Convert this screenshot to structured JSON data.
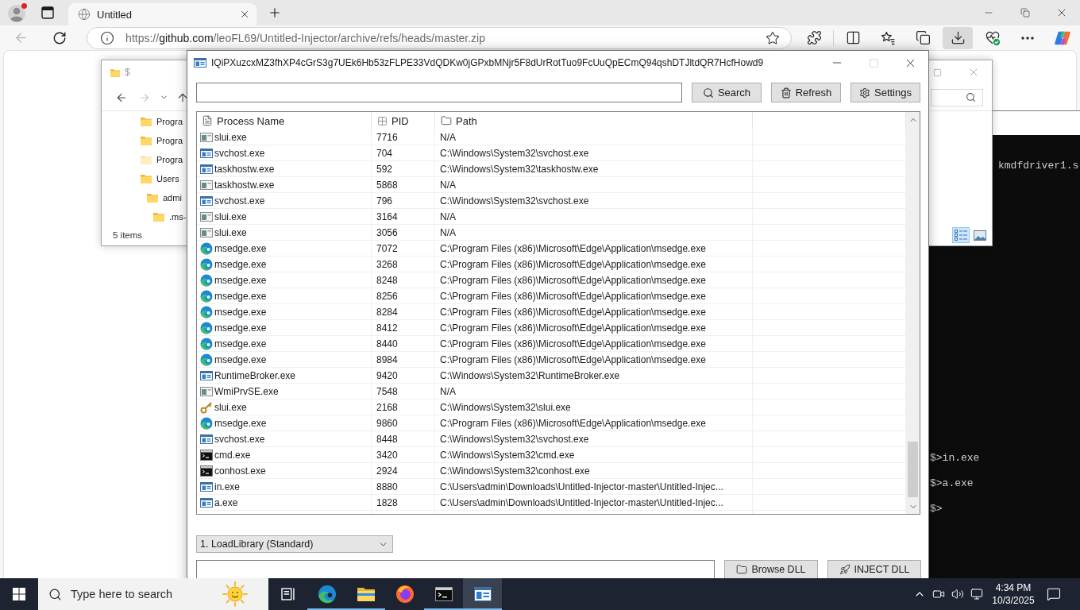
{
  "browser": {
    "tabs": [
      {
        "title": "Untitled",
        "selected": true
      }
    ],
    "nav": [
      {
        "kind": "back",
        "disabled": true
      },
      {
        "kind": "refresh",
        "disabled": false
      }
    ],
    "address": {
      "scheme": "https://",
      "host": "github.com",
      "path": "/leoFL69/Untitled-Injector/archive/refs/heads/master.zip"
    },
    "toolbar": [
      {
        "kind": "extensions",
        "selected": false
      },
      {
        "kind": "split",
        "selected": false
      },
      {
        "kind": "favorites",
        "selected": false
      },
      {
        "kind": "collections",
        "selected": false
      },
      {
        "kind": "downloads",
        "selected": true
      },
      {
        "kind": "essentials",
        "selected": false
      },
      {
        "kind": "more",
        "selected": false
      },
      {
        "kind": "copilot",
        "selected": false
      }
    ]
  },
  "explorer": {
    "title": "$",
    "nav": [
      {
        "kind": "back",
        "disabled": false
      },
      {
        "kind": "forward",
        "disabled": true
      },
      {
        "kind": "recent",
        "disabled": false
      },
      {
        "kind": "up",
        "disabled": false
      }
    ],
    "tree": [
      {
        "label": "Progra",
        "hidden": false
      },
      {
        "label": "Progra",
        "hidden": false
      },
      {
        "label": "Progra",
        "hidden": true
      },
      {
        "label": "Users",
        "hidden": false,
        "children": [
          {
            "label": "admi",
            "hidden": false,
            "children": [
              {
                "label": ".ms-",
                "hidden": false
              }
            ]
          }
        ]
      }
    ],
    "status": "5 items",
    "views": [
      {
        "kind": "details",
        "selected": true
      },
      {
        "kind": "thumbnails",
        "selected": false
      }
    ]
  },
  "console": {
    "output": "kmdfdriver1.s",
    "prompt_lines": [
      "$>in.exe",
      "$>a.exe",
      "$>"
    ]
  },
  "injector": {
    "title": "IQiPXuzcxMZ3fhXP4cGrS3g7UEk6Hb53zFLPE33VdQDKw0jGPxbMNjr5F8dUrRotTuo9FcUuQpECmQ94qshDTJltdQR7HcfHowd9",
    "controls": [
      {
        "kind": "minimize",
        "disabled": false
      },
      {
        "kind": "maximize",
        "disabled": true
      },
      {
        "kind": "close",
        "disabled": false
      }
    ],
    "toolbar_buttons": [
      {
        "kind": "search",
        "label": "Search"
      },
      {
        "kind": "refresh",
        "label": "Refresh"
      },
      {
        "kind": "settings",
        "label": "Settings"
      }
    ],
    "columns": [
      {
        "kind": "document",
        "label": "Process Name"
      },
      {
        "kind": "grid",
        "label": "PID"
      },
      {
        "kind": "folder",
        "label": "Path"
      }
    ],
    "rows": [
      {
        "kind": "app",
        "name": "slui.exe",
        "pid": "7716",
        "path": "N/A"
      },
      {
        "kind": "window",
        "name": "svchost.exe",
        "pid": "704",
        "path": "C:\\Windows\\System32\\svchost.exe"
      },
      {
        "kind": "window",
        "name": "taskhostw.exe",
        "pid": "592",
        "path": "C:\\Windows\\System32\\taskhostw.exe"
      },
      {
        "kind": "app",
        "name": "taskhostw.exe",
        "pid": "5868",
        "path": "N/A"
      },
      {
        "kind": "window",
        "name": "svchost.exe",
        "pid": "796",
        "path": "C:\\Windows\\System32\\svchost.exe"
      },
      {
        "kind": "app",
        "name": "slui.exe",
        "pid": "3164",
        "path": "N/A"
      },
      {
        "kind": "app",
        "name": "slui.exe",
        "pid": "3056",
        "path": "N/A"
      },
      {
        "kind": "edge",
        "name": "msedge.exe",
        "pid": "7072",
        "path": "C:\\Program Files (x86)\\Microsoft\\Edge\\Application\\msedge.exe"
      },
      {
        "kind": "edge",
        "name": "msedge.exe",
        "pid": "3268",
        "path": "C:\\Program Files (x86)\\Microsoft\\Edge\\Application\\msedge.exe"
      },
      {
        "kind": "edge",
        "name": "msedge.exe",
        "pid": "8248",
        "path": "C:\\Program Files (x86)\\Microsoft\\Edge\\Application\\msedge.exe"
      },
      {
        "kind": "edge",
        "name": "msedge.exe",
        "pid": "8256",
        "path": "C:\\Program Files (x86)\\Microsoft\\Edge\\Application\\msedge.exe"
      },
      {
        "kind": "edge",
        "name": "msedge.exe",
        "pid": "8284",
        "path": "C:\\Program Files (x86)\\Microsoft\\Edge\\Application\\msedge.exe"
      },
      {
        "kind": "edge",
        "name": "msedge.exe",
        "pid": "8412",
        "path": "C:\\Program Files (x86)\\Microsoft\\Edge\\Application\\msedge.exe"
      },
      {
        "kind": "edge",
        "name": "msedge.exe",
        "pid": "8440",
        "path": "C:\\Program Files (x86)\\Microsoft\\Edge\\Application\\msedge.exe"
      },
      {
        "kind": "edge",
        "name": "msedge.exe",
        "pid": "8984",
        "path": "C:\\Program Files (x86)\\Microsoft\\Edge\\Application\\msedge.exe"
      },
      {
        "kind": "window",
        "name": "RuntimeBroker.exe",
        "pid": "9420",
        "path": "C:\\Windows\\System32\\RuntimeBroker.exe"
      },
      {
        "kind": "app",
        "name": "WmiPrvSE.exe",
        "pid": "7548",
        "path": "N/A"
      },
      {
        "kind": "key",
        "name": "slui.exe",
        "pid": "2168",
        "path": "C:\\Windows\\System32\\slui.exe"
      },
      {
        "kind": "edge",
        "name": "msedge.exe",
        "pid": "9860",
        "path": "C:\\Program Files (x86)\\Microsoft\\Edge\\Application\\msedge.exe"
      },
      {
        "kind": "window",
        "name": "svchost.exe",
        "pid": "8448",
        "path": "C:\\Windows\\System32\\svchost.exe"
      },
      {
        "kind": "console",
        "name": "cmd.exe",
        "pid": "3420",
        "path": "C:\\Windows\\System32\\cmd.exe"
      },
      {
        "kind": "console",
        "name": "conhost.exe",
        "pid": "2924",
        "path": "C:\\Windows\\System32\\conhost.exe"
      },
      {
        "kind": "window",
        "name": "in.exe",
        "pid": "8880",
        "path": "C:\\Users\\admin\\Downloads\\Untitled-Injector-master\\Untitled-Injec..."
      },
      {
        "kind": "window",
        "name": "a.exe",
        "pid": "1828",
        "path": "C:\\Users\\admin\\Downloads\\Untitled-Injector-master\\Untitled-Injec..."
      }
    ],
    "method": {
      "value": "1. LoadLibrary (Standard)"
    },
    "action_buttons": [
      {
        "kind": "browse",
        "label": "Browse DLL"
      },
      {
        "kind": "inject",
        "label": "INJECT DLL"
      }
    ]
  },
  "taskbar": {
    "search": {
      "placeholder": "Type here to search"
    },
    "apps": [
      {
        "kind": "taskview",
        "running": false,
        "selected": false
      },
      {
        "kind": "edge",
        "running": true,
        "selected": false
      },
      {
        "kind": "explorer",
        "running": true,
        "selected": false
      },
      {
        "kind": "firefox",
        "running": false,
        "selected": false
      },
      {
        "kind": "terminal",
        "running": true,
        "selected": false
      },
      {
        "kind": "injector",
        "running": true,
        "selected": true
      }
    ],
    "clock": {
      "time": "4:34 PM",
      "date": "10/3/2025"
    }
  }
}
